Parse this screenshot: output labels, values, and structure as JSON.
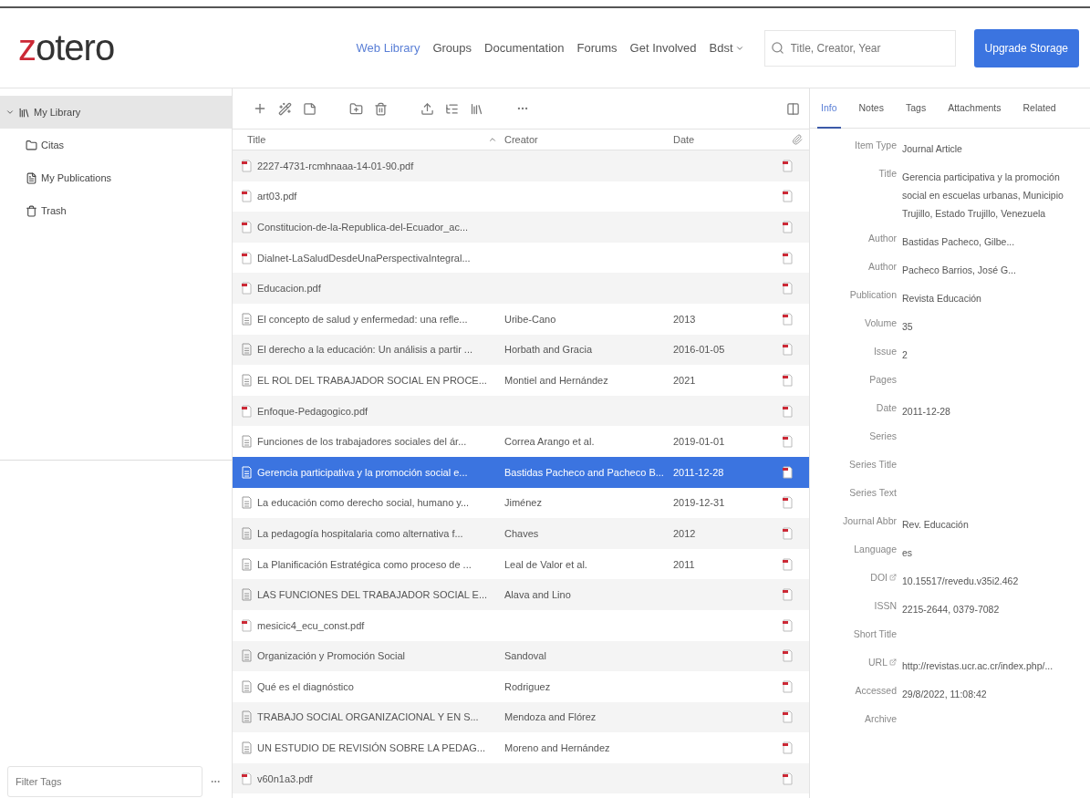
{
  "logo": {
    "first": "z",
    "rest": "otero"
  },
  "nav": [
    {
      "label": "Web Library",
      "selected": true
    },
    {
      "label": "Groups",
      "selected": false
    },
    {
      "label": "Documentation",
      "selected": false
    },
    {
      "label": "Forums",
      "selected": false
    },
    {
      "label": "Get Involved",
      "selected": false
    },
    {
      "label": "Bdst",
      "selected": false,
      "kind": "menu"
    }
  ],
  "search": {
    "placeholder": "Title, Creator, Year"
  },
  "upgrade_button": "Upgrade Storage",
  "sidebar": {
    "items": [
      {
        "label": "My Library",
        "kind": "library",
        "selected": true,
        "expanded": true,
        "children": [
          {
            "label": "Citas",
            "kind": "folder",
            "selected": false
          },
          {
            "label": "My Publications",
            "kind": "publications",
            "selected": false
          },
          {
            "label": "Trash",
            "kind": "trash",
            "selected": false
          }
        ]
      }
    ],
    "tag_filter": {
      "placeholder": "Filter Tags"
    }
  },
  "table": {
    "columns": [
      "Title",
      "Creator",
      "Date"
    ],
    "rows": [
      {
        "kind": "pdf",
        "title": "2227-4731-rcmhnaaa-14-01-90.pdf",
        "selected": false
      },
      {
        "kind": "pdf",
        "title": "art03.pdf",
        "selected": false
      },
      {
        "kind": "pdf",
        "title": "Constitucion-de-la-Republica-del-Ecuador_ac...",
        "selected": false
      },
      {
        "kind": "pdf",
        "title": "Dialnet-LaSaludDesdeUnaPerspectivaIntegral...",
        "selected": false
      },
      {
        "kind": "pdf",
        "title": "Educacion.pdf",
        "selected": false
      },
      {
        "kind": "doc",
        "title": "El concepto de salud y enfermedad: una refle...",
        "creator": "Uribe-Cano",
        "date": "2013",
        "selected": false
      },
      {
        "kind": "doc",
        "title": "El derecho a la educación: Un análisis a partir ...",
        "creator": "Horbath and Gracia",
        "date": "2016-01-05",
        "selected": false
      },
      {
        "kind": "doc",
        "title": "EL ROL DEL TRABAJADOR SOCIAL EN PROCE...",
        "creator": "Montiel and Hernández",
        "date": "2021",
        "selected": false
      },
      {
        "kind": "pdf",
        "title": "Enfoque-Pedagogico.pdf",
        "selected": false
      },
      {
        "kind": "doc",
        "title": "Funciones de los trabajadores sociales del ár...",
        "creator": "Correa Arango et al.",
        "date": "2019-01-01",
        "selected": false
      },
      {
        "kind": "doc",
        "title": "Gerencia participativa y la promoción social e...",
        "creator": "Bastidas Pacheco and Pacheco B...",
        "date": "2011-12-28",
        "selected": true
      },
      {
        "kind": "doc",
        "title": "La educación como derecho social, humano y...",
        "creator": "Jiménez",
        "date": "2019-12-31",
        "selected": false
      },
      {
        "kind": "doc",
        "title": "La pedagogía hospitalaria como alternativa f...",
        "creator": "Chaves",
        "date": "2012",
        "selected": false
      },
      {
        "kind": "doc",
        "title": "La Planificación Estratégica como proceso de ...",
        "creator": "Leal de Valor et al.",
        "date": "2011",
        "selected": false
      },
      {
        "kind": "doc",
        "title": "LAS FUNCIONES DEL TRABAJADOR SOCIAL E...",
        "creator": "Alava and Lino",
        "selected": false
      },
      {
        "kind": "pdf",
        "title": "mesicic4_ecu_const.pdf",
        "selected": false
      },
      {
        "kind": "doc",
        "title": "Organización y Promoción Social",
        "creator": "Sandoval",
        "selected": false
      },
      {
        "kind": "doc",
        "title": "Qué es el diagnóstico",
        "creator": "Rodriguez",
        "selected": false
      },
      {
        "kind": "doc",
        "title": "TRABAJO SOCIAL ORGANIZACIONAL Y EN S...",
        "creator": "Mendoza and Flórez",
        "selected": false
      },
      {
        "kind": "doc",
        "title": "UN ESTUDIO DE REVISIÓN SOBRE LA PEDAG...",
        "creator": "Moreno and Hernández",
        "selected": false
      },
      {
        "kind": "pdf",
        "title": "v60n1a3.pdf",
        "selected": false
      }
    ]
  },
  "item_pane": {
    "tabs": [
      {
        "label": "Info",
        "selected": true
      },
      {
        "label": "Notes",
        "selected": false
      },
      {
        "label": "Tags",
        "selected": false
      },
      {
        "label": "Attachments",
        "selected": false
      },
      {
        "label": "Related",
        "selected": false
      }
    ],
    "fields": [
      {
        "label": "Item Type",
        "value": "Journal Article"
      },
      {
        "label": "Title",
        "value": "Gerencia participativa y la promoción social en escuelas urbanas, Municipio Trujillo, Estado Trujillo, Venezuela"
      },
      {
        "label": "Author",
        "value": "Bastidas Pacheco, Gilbe..."
      },
      {
        "label": "Author",
        "value": "Pacheco Barrios, José G..."
      },
      {
        "label": "Publication",
        "value": "Revista Educación"
      },
      {
        "label": "Volume",
        "value": "35"
      },
      {
        "label": "Issue",
        "value": "2"
      },
      {
        "label": "Pages"
      },
      {
        "label": "Date",
        "value": "2011-12-28"
      },
      {
        "label": "Series"
      },
      {
        "label": "Series Title"
      },
      {
        "label": "Series Text"
      },
      {
        "label": "Journal Abbr",
        "value": "Rev. Educación"
      },
      {
        "label": "Language",
        "value": "es"
      },
      {
        "label": "DOI",
        "value": "10.15517/revedu.v35i2.462",
        "kind": "link"
      },
      {
        "label": "ISSN",
        "value": "2215-2644, 0379-7082"
      },
      {
        "label": "Short Title"
      },
      {
        "label": "URL",
        "value": "http://revistas.ucr.ac.cr/index.php/...",
        "kind": "link"
      },
      {
        "label": "Accessed",
        "value": "29/8/2022, 11:08:42"
      },
      {
        "label": "Archive"
      }
    ]
  }
}
